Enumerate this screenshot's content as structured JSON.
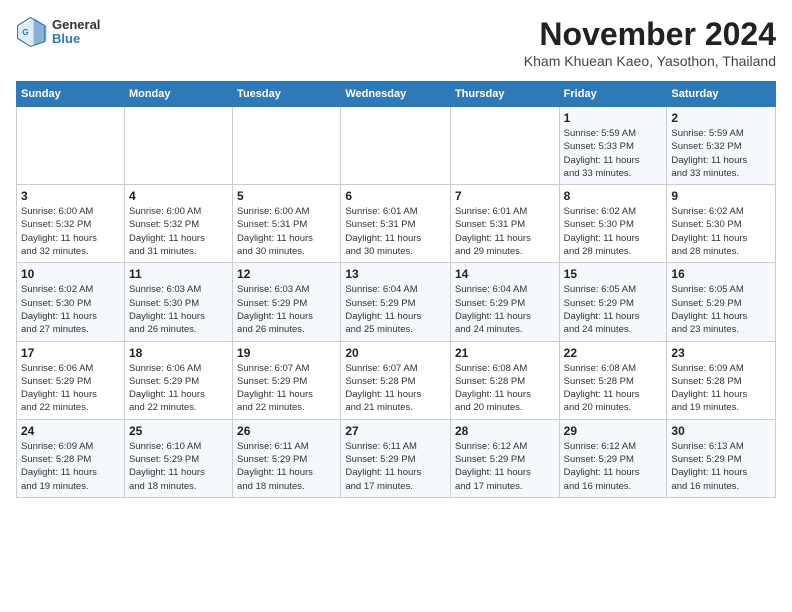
{
  "header": {
    "logo_general": "General",
    "logo_blue": "Blue",
    "month_title": "November 2024",
    "subtitle": "Kham Khuean Kaeo, Yasothon, Thailand"
  },
  "weekdays": [
    "Sunday",
    "Monday",
    "Tuesday",
    "Wednesday",
    "Thursday",
    "Friday",
    "Saturday"
  ],
  "weeks": [
    [
      {
        "day": "",
        "info": ""
      },
      {
        "day": "",
        "info": ""
      },
      {
        "day": "",
        "info": ""
      },
      {
        "day": "",
        "info": ""
      },
      {
        "day": "",
        "info": ""
      },
      {
        "day": "1",
        "info": "Sunrise: 5:59 AM\nSunset: 5:33 PM\nDaylight: 11 hours\nand 33 minutes."
      },
      {
        "day": "2",
        "info": "Sunrise: 5:59 AM\nSunset: 5:32 PM\nDaylight: 11 hours\nand 33 minutes."
      }
    ],
    [
      {
        "day": "3",
        "info": "Sunrise: 6:00 AM\nSunset: 5:32 PM\nDaylight: 11 hours\nand 32 minutes."
      },
      {
        "day": "4",
        "info": "Sunrise: 6:00 AM\nSunset: 5:32 PM\nDaylight: 11 hours\nand 31 minutes."
      },
      {
        "day": "5",
        "info": "Sunrise: 6:00 AM\nSunset: 5:31 PM\nDaylight: 11 hours\nand 30 minutes."
      },
      {
        "day": "6",
        "info": "Sunrise: 6:01 AM\nSunset: 5:31 PM\nDaylight: 11 hours\nand 30 minutes."
      },
      {
        "day": "7",
        "info": "Sunrise: 6:01 AM\nSunset: 5:31 PM\nDaylight: 11 hours\nand 29 minutes."
      },
      {
        "day": "8",
        "info": "Sunrise: 6:02 AM\nSunset: 5:30 PM\nDaylight: 11 hours\nand 28 minutes."
      },
      {
        "day": "9",
        "info": "Sunrise: 6:02 AM\nSunset: 5:30 PM\nDaylight: 11 hours\nand 28 minutes."
      }
    ],
    [
      {
        "day": "10",
        "info": "Sunrise: 6:02 AM\nSunset: 5:30 PM\nDaylight: 11 hours\nand 27 minutes."
      },
      {
        "day": "11",
        "info": "Sunrise: 6:03 AM\nSunset: 5:30 PM\nDaylight: 11 hours\nand 26 minutes."
      },
      {
        "day": "12",
        "info": "Sunrise: 6:03 AM\nSunset: 5:29 PM\nDaylight: 11 hours\nand 26 minutes."
      },
      {
        "day": "13",
        "info": "Sunrise: 6:04 AM\nSunset: 5:29 PM\nDaylight: 11 hours\nand 25 minutes."
      },
      {
        "day": "14",
        "info": "Sunrise: 6:04 AM\nSunset: 5:29 PM\nDaylight: 11 hours\nand 24 minutes."
      },
      {
        "day": "15",
        "info": "Sunrise: 6:05 AM\nSunset: 5:29 PM\nDaylight: 11 hours\nand 24 minutes."
      },
      {
        "day": "16",
        "info": "Sunrise: 6:05 AM\nSunset: 5:29 PM\nDaylight: 11 hours\nand 23 minutes."
      }
    ],
    [
      {
        "day": "17",
        "info": "Sunrise: 6:06 AM\nSunset: 5:29 PM\nDaylight: 11 hours\nand 22 minutes."
      },
      {
        "day": "18",
        "info": "Sunrise: 6:06 AM\nSunset: 5:29 PM\nDaylight: 11 hours\nand 22 minutes."
      },
      {
        "day": "19",
        "info": "Sunrise: 6:07 AM\nSunset: 5:29 PM\nDaylight: 11 hours\nand 22 minutes."
      },
      {
        "day": "20",
        "info": "Sunrise: 6:07 AM\nSunset: 5:28 PM\nDaylight: 11 hours\nand 21 minutes."
      },
      {
        "day": "21",
        "info": "Sunrise: 6:08 AM\nSunset: 5:28 PM\nDaylight: 11 hours\nand 20 minutes."
      },
      {
        "day": "22",
        "info": "Sunrise: 6:08 AM\nSunset: 5:28 PM\nDaylight: 11 hours\nand 20 minutes."
      },
      {
        "day": "23",
        "info": "Sunrise: 6:09 AM\nSunset: 5:28 PM\nDaylight: 11 hours\nand 19 minutes."
      }
    ],
    [
      {
        "day": "24",
        "info": "Sunrise: 6:09 AM\nSunset: 5:28 PM\nDaylight: 11 hours\nand 19 minutes."
      },
      {
        "day": "25",
        "info": "Sunrise: 6:10 AM\nSunset: 5:29 PM\nDaylight: 11 hours\nand 18 minutes."
      },
      {
        "day": "26",
        "info": "Sunrise: 6:11 AM\nSunset: 5:29 PM\nDaylight: 11 hours\nand 18 minutes."
      },
      {
        "day": "27",
        "info": "Sunrise: 6:11 AM\nSunset: 5:29 PM\nDaylight: 11 hours\nand 17 minutes."
      },
      {
        "day": "28",
        "info": "Sunrise: 6:12 AM\nSunset: 5:29 PM\nDaylight: 11 hours\nand 17 minutes."
      },
      {
        "day": "29",
        "info": "Sunrise: 6:12 AM\nSunset: 5:29 PM\nDaylight: 11 hours\nand 16 minutes."
      },
      {
        "day": "30",
        "info": "Sunrise: 6:13 AM\nSunset: 5:29 PM\nDaylight: 11 hours\nand 16 minutes."
      }
    ]
  ]
}
